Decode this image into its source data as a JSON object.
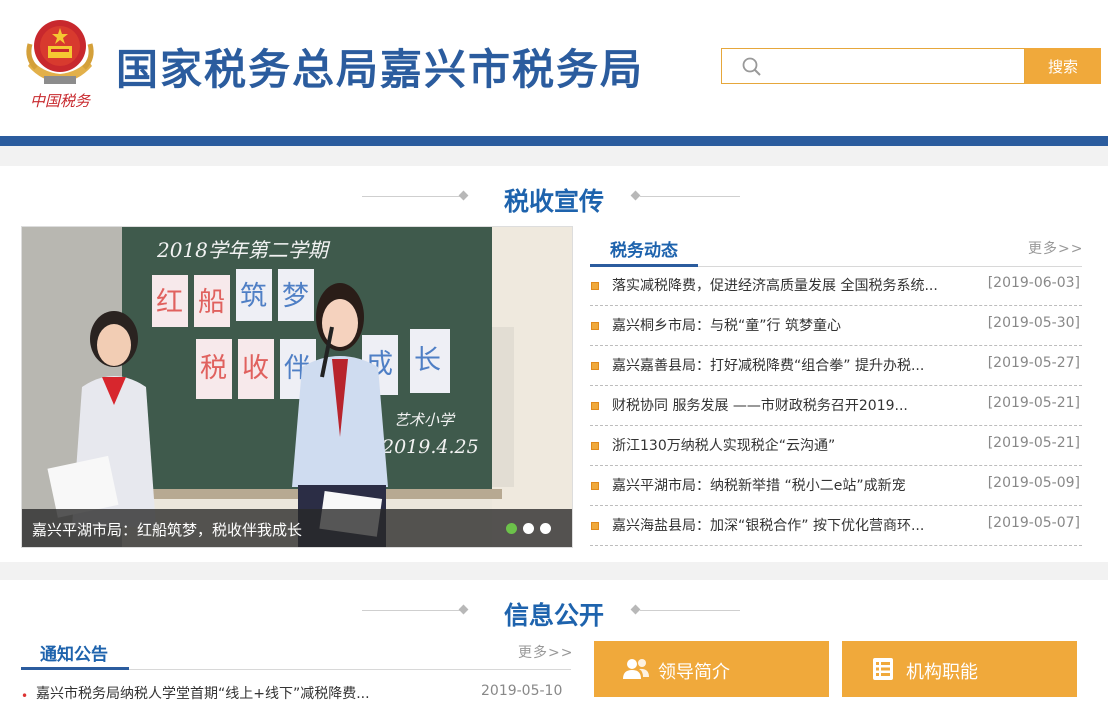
{
  "header": {
    "site_title": "国家税务总局嘉兴市税务局",
    "logo_text": "中国税务",
    "search": {
      "placeholder": "",
      "button_label": "搜索"
    }
  },
  "colors": {
    "brand_blue": "#2b5c9e",
    "heading_blue": "#1e63ad",
    "accent_orange": "#f0a93b",
    "carousel_dot_active": "#6cc24a"
  },
  "tax_promo": {
    "heading": "税收宣传",
    "carousel": {
      "caption": "嘉兴平湖市局：红船筑梦，税收伴我成长",
      "slide_count": 3,
      "active_slide": 1,
      "board_texts": [
        "2018学年第二学期",
        "红",
        "船",
        "筑",
        "梦",
        "税",
        "收",
        "伴",
        "成",
        "长",
        "艺术小学",
        "2019.4.25"
      ]
    },
    "news": {
      "tab_label": "税务动态",
      "more_label": "更多>>",
      "items": [
        {
          "title": "落实减税降费，促进经济高质量发展 全国税务系统...",
          "date": "[2019-06-03]"
        },
        {
          "title": "嘉兴桐乡市局：与税“童”行 筑梦童心",
          "date": "[2019-05-30]"
        },
        {
          "title": "嘉兴嘉善县局：打好减税降费“组合拳” 提升办税...",
          "date": "[2019-05-27]"
        },
        {
          "title": "财税协同 服务发展 ——市财政税务召开2019...",
          "date": "[2019-05-21]"
        },
        {
          "title": "浙江130万纳税人实现税企“云沟通”",
          "date": "[2019-05-21]"
        },
        {
          "title": "嘉兴平湖市局：纳税新举措 “税小二e站”成新宠",
          "date": "[2019-05-09]"
        },
        {
          "title": "嘉兴海盐县局：加深“银税合作” 按下优化营商环...",
          "date": "[2019-05-07]"
        }
      ]
    }
  },
  "info_disclosure": {
    "heading": "信息公开",
    "notice": {
      "tab_label": "通知公告",
      "more_label": "更多>>",
      "items": [
        {
          "title": "嘉兴市税务局纳税人学堂首期“线上+线下”减税降费...",
          "date": "2019-05-10"
        }
      ]
    },
    "quick_links": [
      {
        "label": "领导简介",
        "icon": "users-icon"
      },
      {
        "label": "机构职能",
        "icon": "list-icon"
      }
    ]
  }
}
